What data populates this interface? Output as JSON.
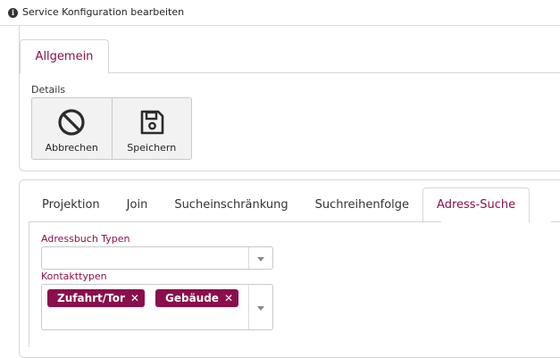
{
  "window": {
    "title": "Service Konfiguration bearbeiten"
  },
  "top_tabs": [
    {
      "label": "Allgemein"
    }
  ],
  "details": {
    "label": "Details",
    "buttons": [
      {
        "label": "Abbrechen",
        "icon": "ban-icon"
      },
      {
        "label": "Speichern",
        "icon": "floppy-disk-icon"
      }
    ]
  },
  "tabs": [
    {
      "label": "Projektion"
    },
    {
      "label": "Join"
    },
    {
      "label": "Sucheinschränkung"
    },
    {
      "label": "Suchreihenfolge"
    },
    {
      "label": "Adress-Suche",
      "active": true
    }
  ],
  "form": {
    "adressbuch": {
      "label": "Adressbuch Typen",
      "value": ""
    },
    "kontakttypen": {
      "label": "Kontakttypen",
      "tags": [
        {
          "label": "Zufahrt/Tor"
        },
        {
          "label": "Gebäude"
        }
      ]
    }
  },
  "colors": {
    "accent": "#8a0f4c"
  }
}
